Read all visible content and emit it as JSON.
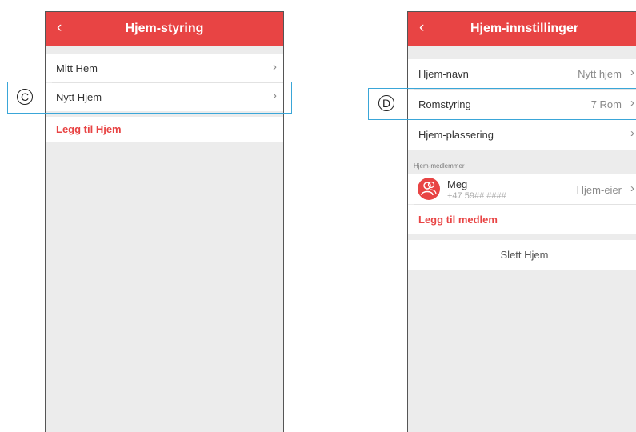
{
  "left_screen": {
    "header": {
      "back_icon": "chevron-left-icon",
      "title": "Hjem-styring"
    },
    "homes": [
      {
        "label": "Mitt Hem"
      },
      {
        "label": "Nytt Hjem"
      }
    ],
    "add_home_label": "Legg til Hjem",
    "callout_letter": "C"
  },
  "right_screen": {
    "header": {
      "back_icon": "chevron-left-icon",
      "title": "Hjem-innstillinger"
    },
    "settings": [
      {
        "label": "Hjem-navn",
        "value": "Nytt hjem"
      },
      {
        "label": "Romstyring",
        "value": "7 Rom"
      },
      {
        "label": "Hjem-plassering",
        "value": ""
      }
    ],
    "members_caption": "Hjem-medlemmer",
    "member": {
      "name": "Meg",
      "phone": "+47 59## ####",
      "role": "Hjem-eier"
    },
    "add_member_label": "Legg til medlem",
    "delete_home_label": "Slett Hjem",
    "callout_letter": "D"
  },
  "colors": {
    "accent": "#e84444",
    "callout_border": "#3aa6d8",
    "background": "#ececec"
  }
}
